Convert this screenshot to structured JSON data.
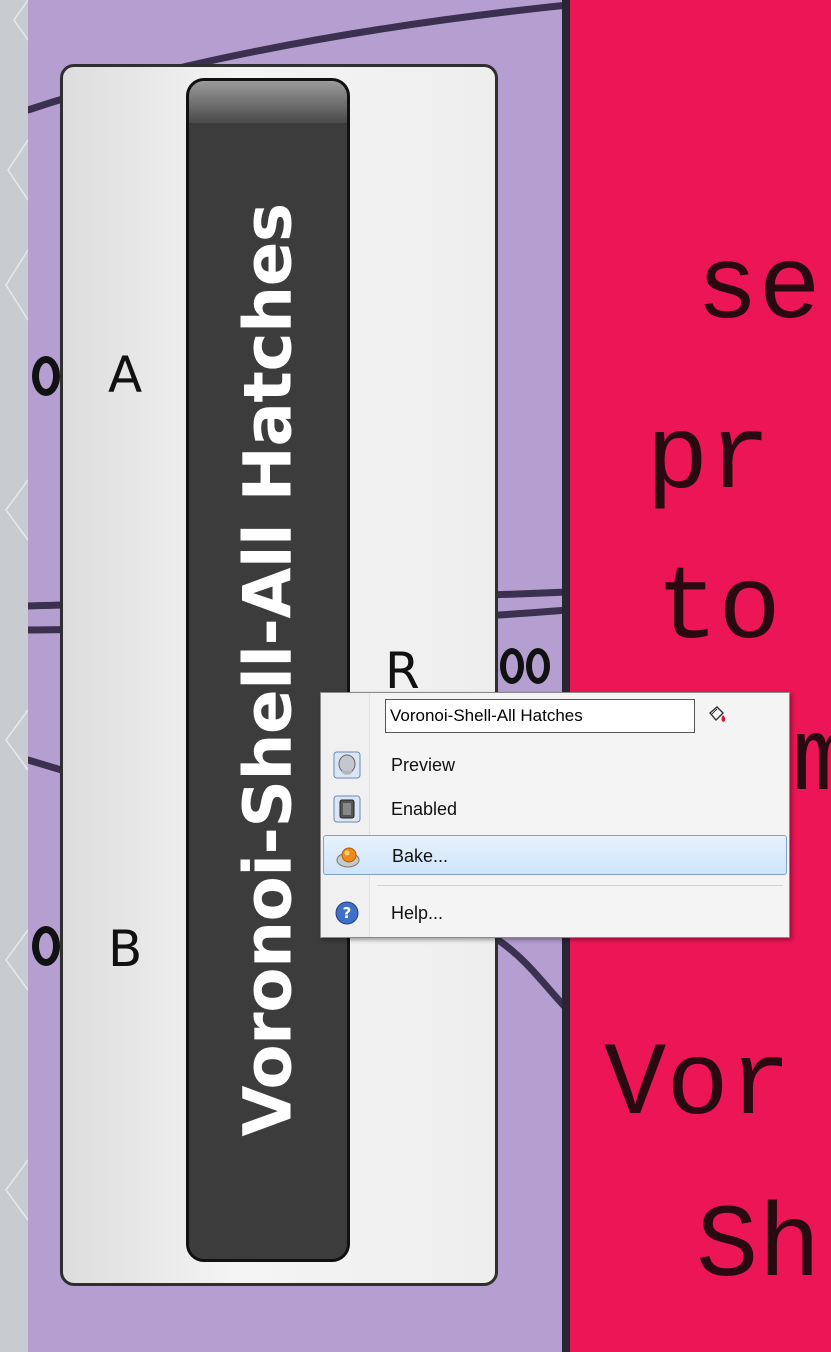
{
  "component": {
    "title": "Voronoi-Shell-All Hatches",
    "inputs": [
      "A",
      "B"
    ],
    "outputs": [
      "R"
    ]
  },
  "context_menu": {
    "name_value": "Voronoi-Shell-All Hatches",
    "items": [
      {
        "label": "Preview",
        "icon": "preview-icon"
      },
      {
        "label": "Enabled",
        "icon": "enabled-icon"
      },
      {
        "label": "Bake...",
        "icon": "bake-icon",
        "selected": true
      },
      {
        "label": "Help...",
        "icon": "help-icon"
      }
    ]
  },
  "note_panel": {
    "lines": [
      "se",
      "pr",
      "to",
      "m",
      "Vor",
      "Sh"
    ]
  },
  "colors": {
    "canvas": "#b59fd1",
    "note": "#ec1556",
    "component_center": "#3c3c3c"
  }
}
